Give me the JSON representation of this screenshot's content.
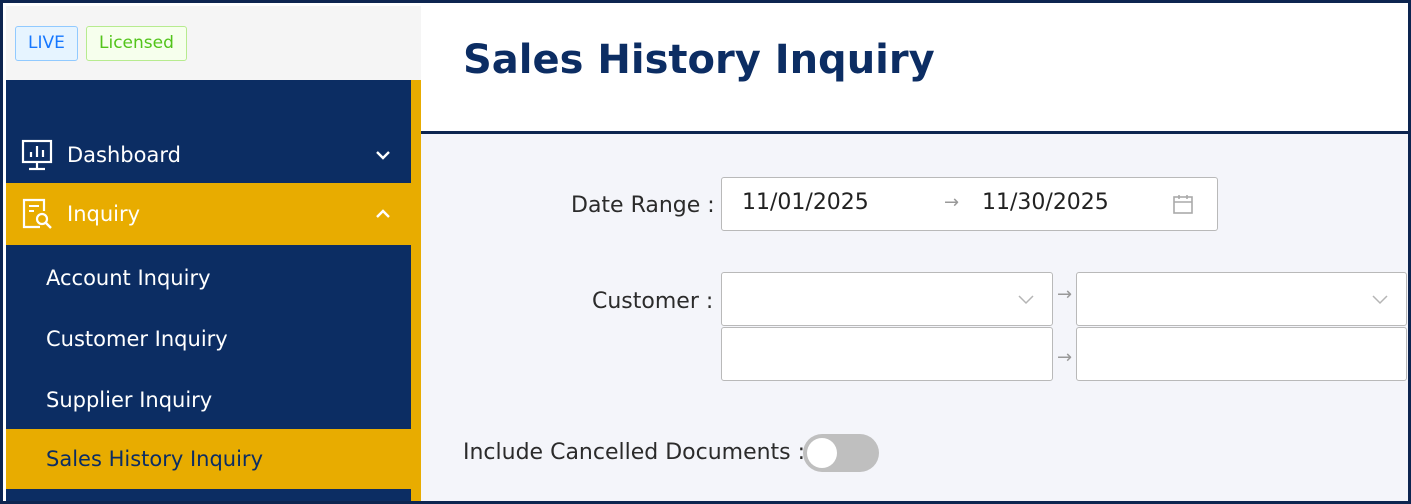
{
  "badges": {
    "live": "LIVE",
    "licensed": "Licensed"
  },
  "sidebar": {
    "menu": [
      {
        "label": "Dashboard",
        "icon": "monitor-chart-icon",
        "expanded": false
      },
      {
        "label": "Inquiry",
        "icon": "search-document-icon",
        "expanded": true
      }
    ],
    "submenu": [
      {
        "label": "Account Inquiry",
        "active": false
      },
      {
        "label": "Customer Inquiry",
        "active": false
      },
      {
        "label": "Supplier Inquiry",
        "active": false
      },
      {
        "label": "Sales History Inquiry",
        "active": true
      }
    ]
  },
  "page": {
    "title": "Sales History Inquiry"
  },
  "form": {
    "date_range": {
      "label": "Date Range :",
      "start": "11/01/2025",
      "end": "11/30/2025"
    },
    "customer": {
      "label": "Customer :"
    },
    "include_cancelled": {
      "label": "Include Cancelled Documents :",
      "value": false
    }
  },
  "colors": {
    "navy": "#0c2d63",
    "gold": "#e8ac00",
    "background": "#f4f5fa"
  }
}
